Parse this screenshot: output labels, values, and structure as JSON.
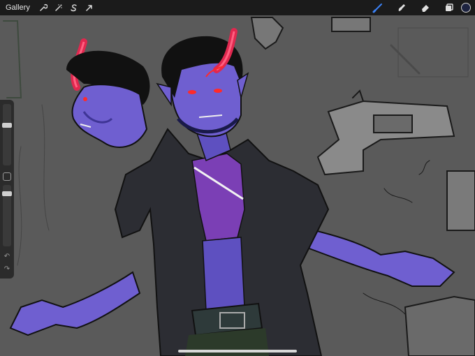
{
  "app": {
    "gallery_label": "Gallery"
  },
  "toolbar": {
    "left_icons": [
      "wrench-icon",
      "magic-wand-icon",
      "selection-s-icon",
      "transform-arrow-icon"
    ],
    "right_icons": [
      "brush-icon",
      "smudge-icon",
      "eraser-icon",
      "layers-icon"
    ],
    "active_tool_color": "#3b82f6",
    "current_color": "#1d2340"
  },
  "sidebar": {
    "brush_size_level": 0.85,
    "opacity_level": 0.9
  },
  "colors": {
    "canvas_bg": "#5a5a5a",
    "skin": "#6f5fd0",
    "skin_shadow": "#3f3596",
    "horn": "#e0284f",
    "coat": "#2c2d33",
    "shirt": "#7b3fb5",
    "hair": "#111111",
    "eyes": "#ff2a2a"
  }
}
